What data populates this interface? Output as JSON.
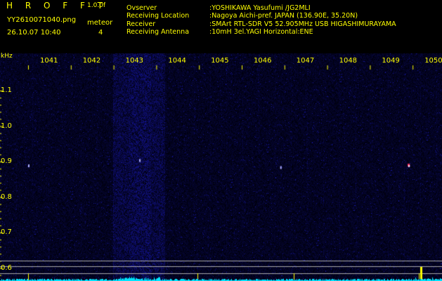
{
  "header": {
    "app_title": "H R O F F T",
    "version": "1.0.0f",
    "filename": "YY2610071040.png",
    "datetime": "26.10.07 10:40",
    "meteor_label": "meteor",
    "meteor_count": "4"
  },
  "info": [
    {
      "key": "Ovserver",
      "value": ":YOSHIKAWA Yasufumi /JG2MLI"
    },
    {
      "key": "Receiving Location",
      "value": ":Nagoya Aichi-pref. JAPAN (136.90E, 35.20N)"
    },
    {
      "key": "Receiver",
      "value": ":SMArt RTL-SDR V5 52.905MHz USB HIGASHIMURAYAMA"
    },
    {
      "key": "Receiving Antenna",
      "value": ":10mH 3el.YAGI Horizontal:ENE"
    }
  ],
  "axis": {
    "y_unit": "kHz",
    "x_ticks": [
      "1041",
      "1042",
      "1043",
      "1044",
      "1045",
      "1046",
      "1047",
      "1048",
      "1049",
      "1050"
    ],
    "y_ticks": [
      "1.1",
      "1.0",
      "0.9",
      "0.8",
      "0.7",
      "0.6"
    ]
  },
  "colors": {
    "background": "#000000",
    "label": "#ffff00",
    "baseline": "#00e5ff",
    "signal_noise": "#2a2a9a"
  },
  "meteor_events": [
    {
      "minute": 1041.0,
      "khz": 0.89
    },
    {
      "minute": 1043.6,
      "khz": 0.905
    },
    {
      "minute": 1046.9,
      "khz": 0.885
    },
    {
      "minute": 1049.9,
      "khz": 0.89
    }
  ]
}
